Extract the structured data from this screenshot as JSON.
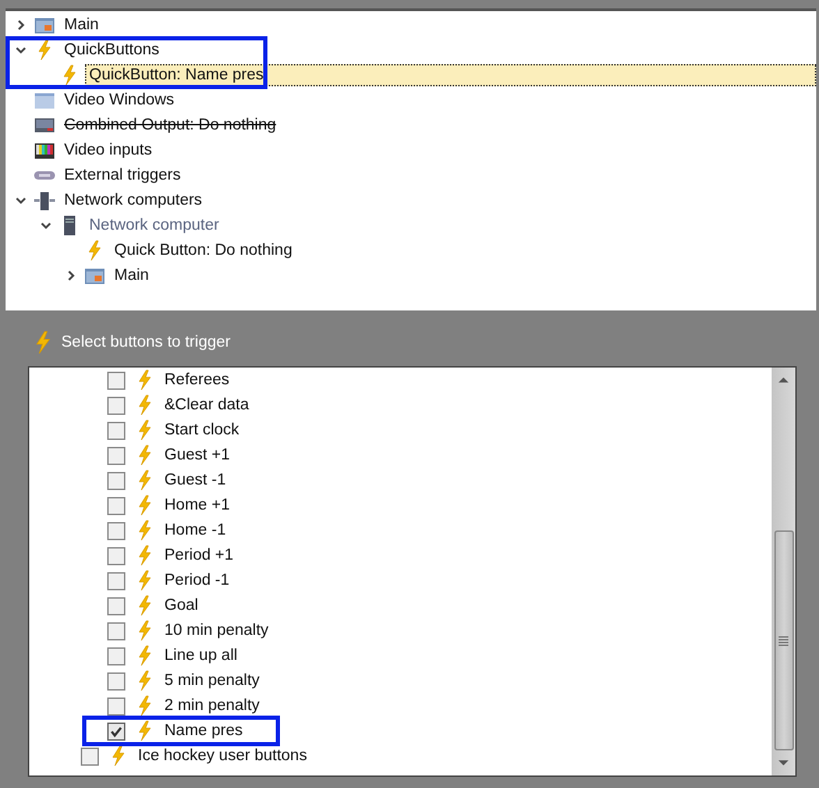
{
  "tree": [
    {
      "label": "Main",
      "kind": "window",
      "expanded": false,
      "selected": false
    },
    {
      "label": "QuickButtons",
      "kind": "bolt",
      "expanded": true,
      "selected": false,
      "children": [
        {
          "label": "QuickButton: Name pres",
          "kind": "bolt",
          "selected": true
        }
      ]
    },
    {
      "label": "Video Windows",
      "kind": "video-window",
      "selected": false
    },
    {
      "label": "Combined Output: Do nothing",
      "kind": "monitor",
      "selected": false,
      "struck": true
    },
    {
      "label": "Video inputs",
      "kind": "color-bars",
      "selected": false
    },
    {
      "label": "External triggers",
      "kind": "trigger",
      "selected": false
    },
    {
      "label": "Network computers",
      "kind": "network",
      "expanded": true,
      "selected": false,
      "children": [
        {
          "label": "Network computer",
          "kind": "computer",
          "expanded": true,
          "selected": false,
          "dimmed": true,
          "children": [
            {
              "label": "Quick Button: Do nothing",
              "kind": "bolt",
              "selected": false
            },
            {
              "label": "Main",
              "kind": "window",
              "expanded": false,
              "selected": false
            }
          ]
        }
      ]
    }
  ],
  "trigger_section": {
    "title": "Select buttons to trigger"
  },
  "buttons": [
    {
      "label": "Referees",
      "kind": "button",
      "checked": false
    },
    {
      "label": "&Clear data",
      "kind": "button",
      "checked": false
    },
    {
      "label": "Start clock",
      "kind": "button",
      "checked": false
    },
    {
      "label": "Guest +1",
      "kind": "button",
      "checked": false
    },
    {
      "label": "Guest -1",
      "kind": "button",
      "checked": false
    },
    {
      "label": "Home +1",
      "kind": "button",
      "checked": false
    },
    {
      "label": "Home -1",
      "kind": "button",
      "checked": false
    },
    {
      "label": "Period +1",
      "kind": "button",
      "checked": false
    },
    {
      "label": "Period -1",
      "kind": "button",
      "checked": false
    },
    {
      "label": "Goal",
      "kind": "button",
      "checked": false
    },
    {
      "label": "10 min penalty",
      "kind": "button",
      "checked": false
    },
    {
      "label": "Line up all",
      "kind": "button",
      "checked": false
    },
    {
      "label": "5 min penalty",
      "kind": "button",
      "checked": false
    },
    {
      "label": "2 min penalty",
      "kind": "button",
      "checked": false
    },
    {
      "label": "Name pres",
      "kind": "button",
      "checked": true
    },
    {
      "label": "Ice hockey user buttons",
      "kind": "group",
      "checked": false
    }
  ]
}
